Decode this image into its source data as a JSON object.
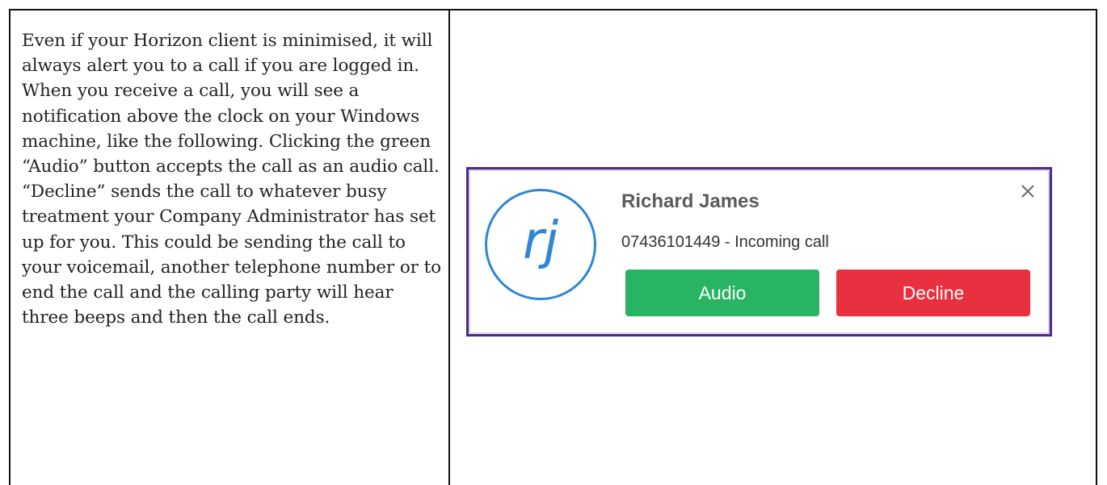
{
  "document": {
    "paragraph": "Even if your Horizon client is minimised, it will always alert you to a call if you are logged in. When you receive a call, you will see a notification above the clock on your Windows machine, like the following. Clicking the green “Audio” button accepts the call as an audio call. “Decline” sends the call to whatever busy treatment your Company Administrator has set up for you. This could be sending the call to your voicemail, another telephone number or to end the call and the calling party will hear three beeps and then the call ends."
  },
  "notification": {
    "avatar_initials": "rj",
    "caller_name": "Richard James",
    "caller_status": "07436101449 - Incoming call",
    "audio_label": "Audio",
    "decline_label": "Decline",
    "close_icon": "close-icon",
    "colors": {
      "border": "#4b2a8a",
      "avatar": "#2f86d6",
      "audio": "#28b463",
      "decline": "#e8303e"
    }
  }
}
